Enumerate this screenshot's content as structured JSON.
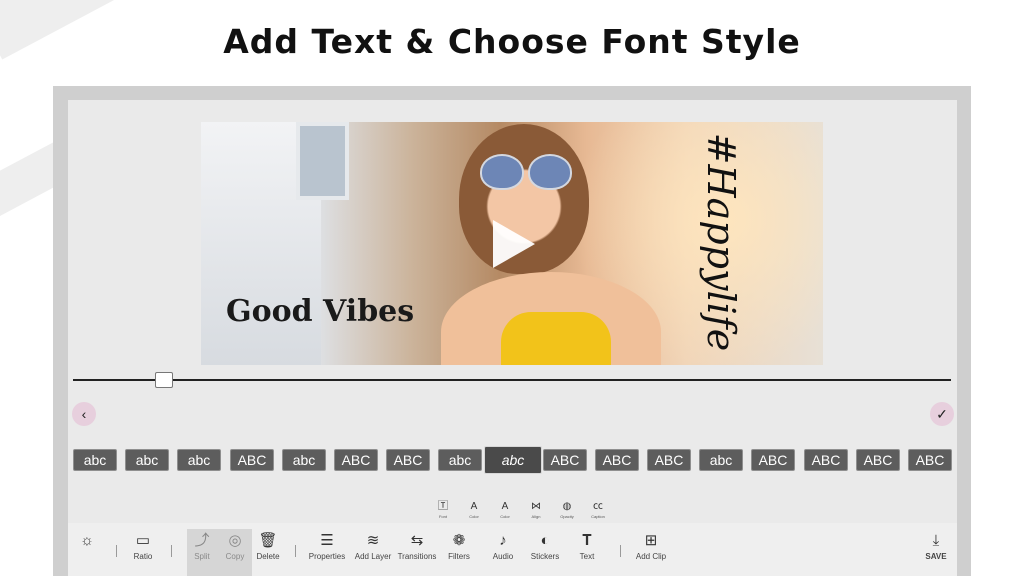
{
  "headline": "Add Text & Choose Font Style",
  "preview": {
    "overlay_text_1": "Good Vibes",
    "overlay_text_2": "#Happylife"
  },
  "timeline": {
    "position_fraction": 0.1
  },
  "font_styles": [
    {
      "label": "abc",
      "style": "rounded"
    },
    {
      "label": "abc",
      "style": "handwritten"
    },
    {
      "label": "abc",
      "style": "serif"
    },
    {
      "label": "ABC",
      "style": "slab"
    },
    {
      "label": "abc",
      "style": "light"
    },
    {
      "label": "ABC",
      "style": "outline-thin"
    },
    {
      "label": "ABC",
      "style": "stencil"
    },
    {
      "label": "abc",
      "style": "condensed"
    },
    {
      "label": "abc",
      "style": "script",
      "selected": true
    },
    {
      "label": "ABC",
      "style": "outline"
    },
    {
      "label": "ABC",
      "style": "tiny"
    },
    {
      "label": "ABC",
      "style": "shadow"
    },
    {
      "label": "abc",
      "style": "small-script"
    },
    {
      "label": "ABC",
      "style": "bold"
    },
    {
      "label": "ABC",
      "style": "mixed"
    },
    {
      "label": "ABC",
      "style": "heavy"
    },
    {
      "label": "ABC",
      "style": "block"
    }
  ],
  "text_tools": [
    {
      "label": "Font",
      "icon": "T-box-icon"
    },
    {
      "label": "Color",
      "icon": "A-underline-icon"
    },
    {
      "label": "Color",
      "icon": "A-underline-icon"
    },
    {
      "label": "Align",
      "icon": "align-icon"
    },
    {
      "label": "Opacity",
      "icon": "opacity-icon"
    },
    {
      "label": "Caption",
      "icon": "cc-icon"
    }
  ],
  "toolbar": {
    "brightness_icon": "sun-icon",
    "ratio": "Ratio",
    "split": "Split",
    "copy": "Copy",
    "delete": "Delete",
    "properties": "Properties",
    "add_layer": "Add Layer",
    "transitions": "Transitions",
    "filters": "Filters",
    "audio": "Audio",
    "stickers": "Stickers",
    "text": "Text",
    "add_clip": "Add Clip",
    "save": "SAVE"
  }
}
